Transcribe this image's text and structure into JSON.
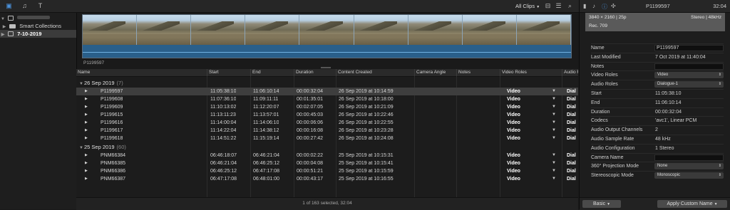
{
  "browser": {
    "filter_label": "All Clips",
    "library_name": "",
    "sidebar_items": [
      {
        "label": "Smart Collections"
      },
      {
        "label": "7-10-2019"
      }
    ],
    "filmstrip_clip_name": "P1199597"
  },
  "list": {
    "columns": [
      "Name",
      "Start",
      "End",
      "Duration",
      "Content Created",
      "Camera Angle",
      "Notes",
      "Video Roles",
      "Audio Ro"
    ],
    "groups": [
      {
        "title": "26 Sep 2019",
        "count": "(7)",
        "rows": [
          {
            "name": "P1199597",
            "start": "11:05:38:10",
            "end": "11:06:10:14",
            "duration": "00:00:32:04",
            "created": "26 Sep 2019 at 10:14:59",
            "video_role": "Video",
            "audio_role": "Dial"
          },
          {
            "name": "P1199608",
            "start": "11:07:36:10",
            "end": "11:09:11:11",
            "duration": "00:01:35:01",
            "created": "26 Sep 2019 at 10:18:00",
            "video_role": "Video",
            "audio_role": "Dial"
          },
          {
            "name": "P1199609",
            "start": "11:10:13:02",
            "end": "11:12:20:07",
            "duration": "00:02:07:05",
            "created": "26 Sep 2019 at 10:21:09",
            "video_role": "Video",
            "audio_role": "Dial"
          },
          {
            "name": "P1199615",
            "start": "11:13:11:23",
            "end": "11:13:57:01",
            "duration": "00:00:45:03",
            "created": "26 Sep 2019 at 10:22:46",
            "video_role": "Video",
            "audio_role": "Dial"
          },
          {
            "name": "P1199616",
            "start": "11:14:00:04",
            "end": "11:14:06:10",
            "duration": "00:00:06:06",
            "created": "26 Sep 2019 at 10:22:55",
            "video_role": "Video",
            "audio_role": "Dial"
          },
          {
            "name": "P1199617",
            "start": "11:14:22:04",
            "end": "11:14:38:12",
            "duration": "00:00:16:08",
            "created": "26 Sep 2019 at 10:23:28",
            "video_role": "Video",
            "audio_role": "Dial"
          },
          {
            "name": "P1199618",
            "start": "11:14:51:22",
            "end": "11:15:19:14",
            "duration": "00:00:27:42",
            "created": "26 Sep 2019 at 10:24:08",
            "video_role": "Video",
            "audio_role": "Dial"
          }
        ]
      },
      {
        "title": "25 Sep 2019",
        "count": "(60)",
        "rows": [
          {
            "name": "PNM66384",
            "start": "06:46:18:07",
            "end": "06:46:21:04",
            "duration": "00:00:02:22",
            "created": "25 Sep 2019 at 10:15:31",
            "video_role": "Video",
            "audio_role": "Dial"
          },
          {
            "name": "PNM66385",
            "start": "06:46:21:04",
            "end": "06:46:25:12",
            "duration": "00:00:04:08",
            "created": "25 Sep 2019 at 10:15:41",
            "video_role": "Video",
            "audio_role": "Dial"
          },
          {
            "name": "PNM66386",
            "start": "06:46:25:12",
            "end": "06:47:17:08",
            "duration": "00:00:51:21",
            "created": "25 Sep 2019 at 10:15:59",
            "video_role": "Video",
            "audio_role": "Dial"
          },
          {
            "name": "PNM66387",
            "start": "06:47:17:08",
            "end": "06:48:01:00",
            "duration": "00:00:43:17",
            "created": "25 Sep 2019 at 10:16:55",
            "video_role": "Video",
            "audio_role": "Dial"
          }
        ]
      }
    ],
    "status": "1 of 163 selected, 32:04"
  },
  "inspector": {
    "title": "P1199597",
    "timecode": "32:04",
    "format": "3840 × 2160 | 25p",
    "audio_format": "Stereo | 48kHz",
    "color_space": "Rec. 709",
    "fields": [
      {
        "label": "Name",
        "value": "P1199597",
        "kind": "field"
      },
      {
        "label": "Last Modified",
        "value": "7 Oct 2019 at 11:40:04",
        "kind": "text"
      },
      {
        "label": "Notes",
        "value": "",
        "kind": "field"
      },
      {
        "label": "Video Roles",
        "value": "Video",
        "kind": "select"
      },
      {
        "label": "Audio Roles",
        "value": "Dialogue-1",
        "kind": "select"
      },
      {
        "label": "Start",
        "value": "11:05:38:10",
        "kind": "text"
      },
      {
        "label": "End",
        "value": "11:06:10:14",
        "kind": "text"
      },
      {
        "label": "Duration",
        "value": "00:00:32:04",
        "kind": "text"
      },
      {
        "label": "Codecs",
        "value": "'avc1', Linear PCM",
        "kind": "text"
      },
      {
        "label": "Audio Output Channels",
        "value": "2",
        "kind": "text"
      },
      {
        "label": "Audio Sample Rate",
        "value": "48 kHz",
        "kind": "text"
      },
      {
        "label": "Audio Configuration",
        "value": "1 Stereo",
        "kind": "text"
      },
      {
        "label": "Camera Name",
        "value": "",
        "kind": "field"
      },
      {
        "label": "360° Projection Mode",
        "value": "None",
        "kind": "select"
      },
      {
        "label": "Stereoscopic Mode",
        "value": "Monoscopic",
        "kind": "select"
      }
    ],
    "basic_button": "Basic",
    "apply_button": "Apply Custom Name"
  }
}
